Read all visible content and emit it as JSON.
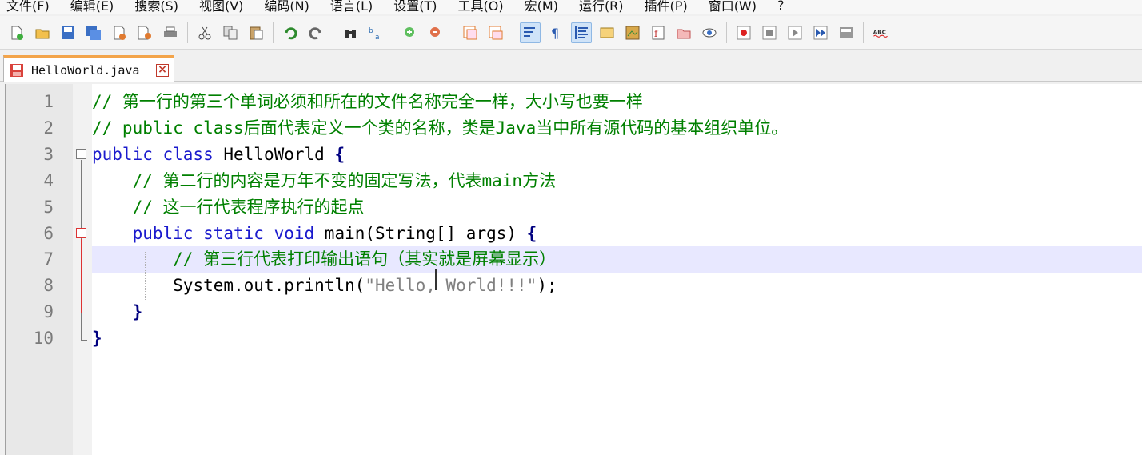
{
  "menu": [
    "文件(F)",
    "编辑(E)",
    "搜索(S)",
    "视图(V)",
    "编码(N)",
    "语言(L)",
    "设置(T)",
    "工具(O)",
    "宏(M)",
    "运行(R)",
    "插件(P)",
    "窗口(W)",
    "?"
  ],
  "toolbar": {
    "icons": [
      "new-file-icon",
      "open-file-icon",
      "save-icon",
      "save-all-icon",
      "close-icon",
      "close-all-icon",
      "print-icon",
      "cut-icon",
      "copy-icon",
      "paste-icon",
      "undo-icon",
      "redo-icon",
      "find-icon",
      "replace-icon",
      "zoom-in-icon",
      "zoom-out-icon",
      "sync-vertical-icon",
      "sync-horizontal-icon",
      "word-wrap-icon",
      "show-all-chars-icon",
      "indent-guide-icon",
      "user-lang-icon",
      "doc-map-icon",
      "function-list-icon",
      "folder-workspace-icon",
      "monitor-icon",
      "record-macro-icon",
      "stop-record-icon",
      "play-macro-icon",
      "run-macro-multiple-icon",
      "save-macro-icon",
      "spell-check-icon"
    ],
    "spell_label": "ABC"
  },
  "tab": {
    "label": "HelloWorld.java",
    "close": "×"
  },
  "editor": {
    "line_numbers": [
      "1",
      "2",
      "3",
      "4",
      "5",
      "6",
      "7",
      "8",
      "9",
      "10"
    ],
    "lines": [
      "// 第一行的第三个单词必须和所在的文件名称完全一样，大小写也要一样",
      "// public class后面代表定义一个类的名称，类是Java当中所有源代码的基本组织单位。",
      "public class HelloWorld {",
      "    // 第二行的内容是万年不变的固定写法，代表main方法",
      "    // 这一行代表程序执行的起点",
      "    public static void main(String[] args) {",
      "        // 第三行代表打印输出语句（其实就是屏幕显示）",
      "        System.out.println(\"Hello, World!!!\");",
      "    }",
      "}"
    ],
    "tokens": {
      "l3_kw": "public class ",
      "l3_name": "HelloWorld ",
      "l3_brace": "{",
      "l6_indent": "    ",
      "l6_kw": "public static void ",
      "l6_rest": "main(String[] args) ",
      "l6_brace": "{",
      "l8_indent": "        ",
      "l8_call": "System.out.println(",
      "l8_str": "\"Hello, World!!!\"",
      "l8_end": ");",
      "l9_indent": "    ",
      "l9_brace": "}",
      "l10_brace": "}"
    },
    "colors": {
      "comment": "#008000",
      "keyword": "#1a1acd",
      "string": "#808080",
      "current_line": "#e8e8ff"
    }
  }
}
